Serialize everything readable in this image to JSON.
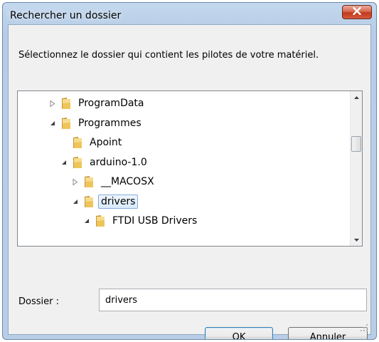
{
  "dialog": {
    "title": "Rechercher un dossier",
    "description": "Sélectionnez le dossier qui contient les pilotes de votre matériel."
  },
  "tree": {
    "items": [
      {
        "label": "ProgramData",
        "expander": "collapsed"
      },
      {
        "label": "Programmes",
        "expander": "expanded"
      },
      {
        "label": "Apoint",
        "expander": "none"
      },
      {
        "label": "arduino-1.0",
        "expander": "expanded"
      },
      {
        "label": "__MACOSX",
        "expander": "collapsed"
      },
      {
        "label": "drivers",
        "expander": "expanded",
        "selected": true
      },
      {
        "label": "FTDI USB Drivers",
        "expander": "expanded"
      }
    ]
  },
  "folder_field": {
    "label": "Dossier :",
    "value": "drivers"
  },
  "buttons": {
    "ok": "OK",
    "cancel": "Annuler"
  },
  "colors": {
    "titlebar": "#b9cee6",
    "close": "#c1391b",
    "selection": "#d9ebfb",
    "folder": "#e8b93a"
  }
}
